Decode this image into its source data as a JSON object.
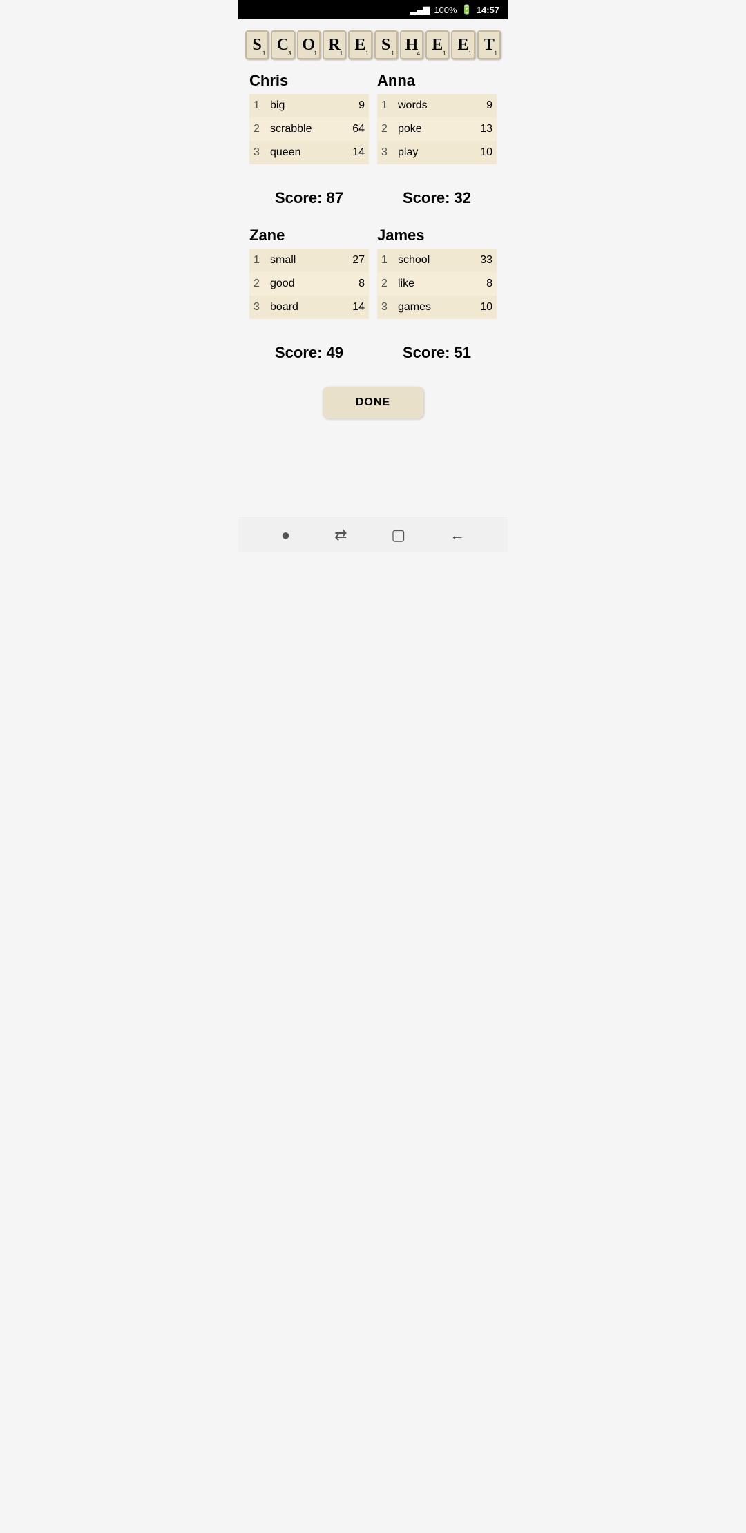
{
  "statusBar": {
    "signal": "▂▄▆█",
    "battery": "100%",
    "time": "14:57"
  },
  "title": {
    "letters": [
      {
        "char": "S",
        "points": "1"
      },
      {
        "char": "C",
        "points": "3"
      },
      {
        "char": "O",
        "points": "1"
      },
      {
        "char": "R",
        "points": "1"
      },
      {
        "char": "E",
        "points": "1"
      },
      {
        "char": "S",
        "points": "1"
      },
      {
        "char": "H",
        "points": "4"
      },
      {
        "char": "E",
        "points": "1"
      },
      {
        "char": "E",
        "points": "1"
      },
      {
        "char": "T",
        "points": "1"
      }
    ]
  },
  "players": [
    {
      "name": "Chris",
      "entries": [
        {
          "num": 1,
          "word": "big",
          "score": 9
        },
        {
          "num": 2,
          "word": "scrabble",
          "score": 64
        },
        {
          "num": 3,
          "word": "queen",
          "score": 14
        }
      ],
      "total": "Score: 87"
    },
    {
      "name": "Anna",
      "entries": [
        {
          "num": 1,
          "word": "words",
          "score": 9
        },
        {
          "num": 2,
          "word": "poke",
          "score": 13
        },
        {
          "num": 3,
          "word": "play",
          "score": 10
        }
      ],
      "total": "Score: 32"
    },
    {
      "name": "Zane",
      "entries": [
        {
          "num": 1,
          "word": "small",
          "score": 27
        },
        {
          "num": 2,
          "word": "good",
          "score": 8
        },
        {
          "num": 3,
          "word": "board",
          "score": 14
        }
      ],
      "total": "Score: 49"
    },
    {
      "name": "James",
      "entries": [
        {
          "num": 1,
          "word": "school",
          "score": 33
        },
        {
          "num": 2,
          "word": "like",
          "score": 8
        },
        {
          "num": 3,
          "word": "games",
          "score": 10
        }
      ],
      "total": "Score: 51"
    }
  ],
  "doneButton": "DONE",
  "nav": {
    "dot": "●",
    "arrows": "⇄",
    "square": "▢",
    "back": "←"
  }
}
